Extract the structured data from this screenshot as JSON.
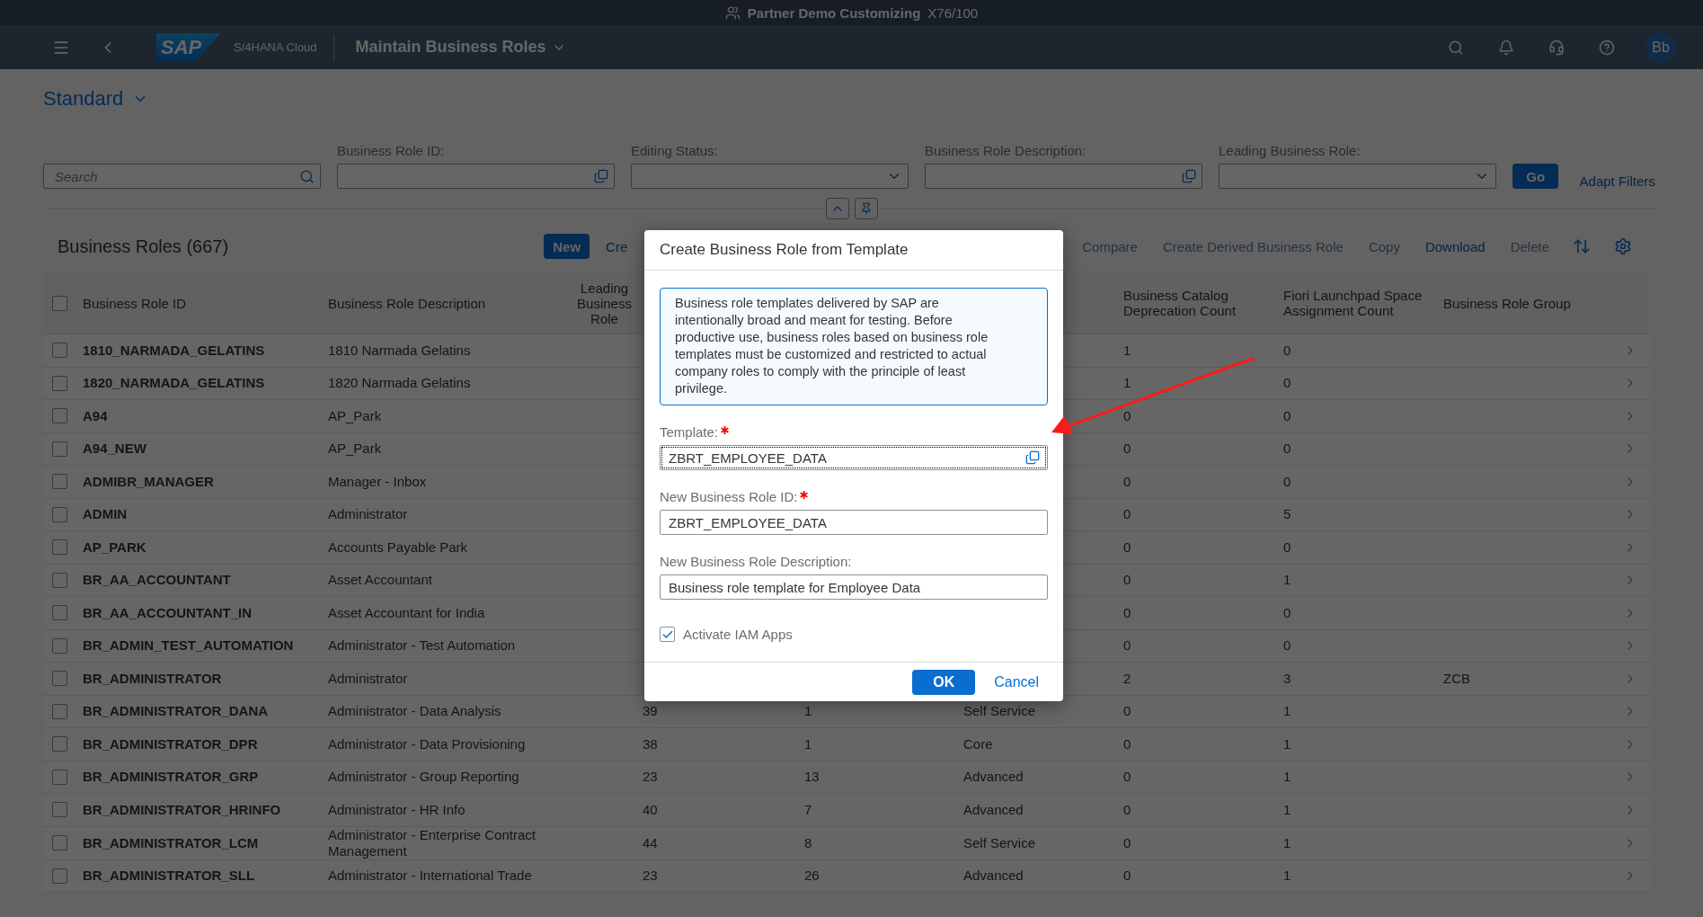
{
  "title_bar": {
    "system": "Partner Demo Customizing",
    "client": "X76/100"
  },
  "shell": {
    "logo": "SAP",
    "product": "S/4HANA Cloud",
    "app_title": "Maintain Business Roles",
    "avatar": "Bb"
  },
  "variant": "Standard",
  "filter_bar": {
    "search": {
      "placeholder": "Search"
    },
    "fields": [
      {
        "label": "Business Role ID:",
        "kind": "valuehelp"
      },
      {
        "label": "Editing Status:",
        "kind": "dropdown"
      },
      {
        "label": "Business Role Description:",
        "kind": "valuehelp"
      },
      {
        "label": "Leading Business Role:",
        "kind": "dropdown"
      }
    ],
    "go": "Go",
    "adapt": "Adapt Filters"
  },
  "table": {
    "title": "Business Roles (667)",
    "actions_left": [
      {
        "label": "New",
        "kind": "emphasized",
        "disabled": false
      },
      {
        "label": "Cre",
        "kind": "link",
        "disabled": false
      }
    ],
    "actions_right": [
      {
        "label": "Compare",
        "kind": "link",
        "disabled": true
      },
      {
        "label": "Create Derived Business Role",
        "kind": "link",
        "disabled": true
      },
      {
        "label": "Copy",
        "kind": "link",
        "disabled": true
      },
      {
        "label": "Download",
        "kind": "link",
        "disabled": false
      },
      {
        "label": "Delete",
        "kind": "link",
        "disabled": true
      }
    ],
    "select_all": {
      "checked": false
    },
    "columns": {
      "id": "Business Role ID",
      "description": "Business Role Description",
      "leading": "Leading Business Role",
      "catalog_deprecation": "Business Catalog Deprecation Count",
      "space_assignment": "Fiori Launchpad Space Assignment Count",
      "group": "Business Role Group"
    },
    "rows": [
      {
        "selected": false,
        "id": "1810_NARMADA_GELATINS",
        "description": "1810 Narmada Gelatins",
        "catalog_deprecation": "1",
        "space_assignment": "0"
      },
      {
        "selected": false,
        "id": "1820_NARMADA_GELATINS",
        "description": "1820 Narmada Gelatins",
        "catalog_deprecation": "1",
        "space_assignment": "0"
      },
      {
        "selected": false,
        "id": "A94",
        "description": "AP_Park",
        "catalog_deprecation": "0",
        "space_assignment": "0"
      },
      {
        "selected": false,
        "id": "A94_NEW",
        "description": "AP_Park",
        "catalog_deprecation": "0",
        "space_assignment": "0"
      },
      {
        "selected": false,
        "id": "ADMIBR_MANAGER",
        "description": "Manager - Inbox",
        "catalog_deprecation": "0",
        "space_assignment": "0"
      },
      {
        "selected": false,
        "id": "ADMIN",
        "description": "Administrator",
        "catalog_deprecation": "0",
        "space_assignment": "5"
      },
      {
        "selected": false,
        "id": "AP_PARK",
        "description": "Accounts Payable Park",
        "catalog_deprecation": "0",
        "space_assignment": "0"
      },
      {
        "selected": false,
        "id": "BR_AA_ACCOUNTANT",
        "description": "Asset Accountant",
        "catalog_deprecation": "0",
        "space_assignment": "1"
      },
      {
        "selected": false,
        "id": "BR_AA_ACCOUNTANT_IN",
        "description": "Asset Accountant for India",
        "catalog_deprecation": "0",
        "space_assignment": "0"
      },
      {
        "selected": false,
        "id": "BR_ADMIN_TEST_AUTOMATION",
        "description": "Administrator - Test Automation",
        "catalog_deprecation": "0",
        "space_assignment": "0"
      },
      {
        "selected": false,
        "id": "BR_ADMINISTRATOR",
        "description": "Administrator",
        "catalog_deprecation": "2",
        "space_assignment": "3",
        "group": "ZCB"
      },
      {
        "selected": false,
        "id": "BR_ADMINISTRATOR_DANA",
        "description": "Administrator - Data Analysis",
        "column_4": "39",
        "column_5": "1",
        "column_6": "Self Service",
        "catalog_deprecation": "0",
        "space_assignment": "1"
      },
      {
        "selected": false,
        "id": "BR_ADMINISTRATOR_DPR",
        "description": "Administrator - Data Provisioning",
        "column_4": "38",
        "column_5": "1",
        "column_6": "Core",
        "catalog_deprecation": "0",
        "space_assignment": "1"
      },
      {
        "selected": false,
        "id": "BR_ADMINISTRATOR_GRP",
        "description": "Administrator - Group Reporting",
        "column_4": "23",
        "column_5": "13",
        "column_6": "Advanced",
        "catalog_deprecation": "0",
        "space_assignment": "1"
      },
      {
        "selected": false,
        "id": "BR_ADMINISTRATOR_HRINFO",
        "description": "Administrator - HR Info",
        "column_4": "40",
        "column_5": "7",
        "column_6": "Advanced",
        "catalog_deprecation": "0",
        "space_assignment": "1"
      },
      {
        "selected": false,
        "id": "BR_ADMINISTRATOR_LCM",
        "description": "Administrator - Enterprise Contract Management",
        "column_4": "44",
        "column_5": "8",
        "column_6": "Self Service",
        "catalog_deprecation": "0",
        "space_assignment": "1"
      },
      {
        "selected": false,
        "id": "BR_ADMINISTRATOR_SLL",
        "description": "Administrator - International Trade",
        "column_4": "23",
        "column_5": "26",
        "column_6": "Advanced",
        "catalog_deprecation": "0",
        "space_assignment": "1"
      }
    ]
  },
  "dialog": {
    "title": "Create Business Role from Template",
    "info": "Business role templates delivered by SAP are intentionally broad and meant for testing. Before productive use, business roles based on business role templates must be customized and restricted to actual company roles to comply with the principle of least privilege.",
    "fields": [
      {
        "label": "Template:",
        "required": true,
        "value": "ZBRT_EMPLOYEE_DATA",
        "kind": "valuehelp",
        "focused": true
      },
      {
        "label": "New Business Role ID:",
        "required": true,
        "value": "ZBRT_EMPLOYEE_DATA",
        "kind": "text",
        "focused": false
      },
      {
        "label": "New Business Role Description:",
        "required": false,
        "value": "Business role template for Employee Data",
        "kind": "text",
        "focused": false
      }
    ],
    "checkbox": {
      "label": "Activate IAM Apps",
      "checked": true
    },
    "ok": "OK",
    "cancel": "Cancel"
  }
}
